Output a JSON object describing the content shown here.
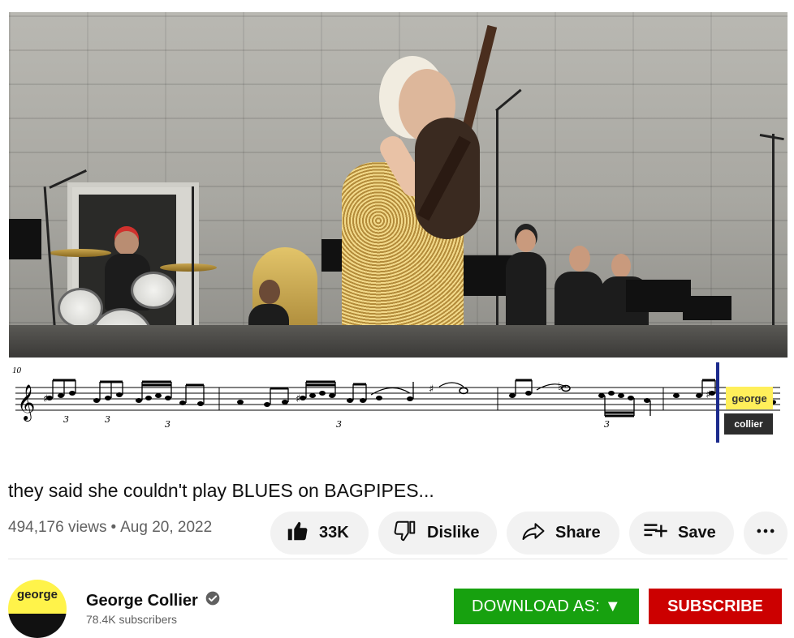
{
  "video": {
    "score": {
      "measure_number": "10",
      "watermark_top": "george",
      "watermark_bottom": "collier"
    }
  },
  "title": "they said she couldn't play BLUES on BAGPIPES...",
  "meta": {
    "views": "494,176 views",
    "separator": "•",
    "date": "Aug 20, 2022"
  },
  "actions": {
    "like_count": "33K",
    "dislike_label": "Dislike",
    "share_label": "Share",
    "save_label": "Save"
  },
  "channel": {
    "avatar_text": "george",
    "name": "George Collier",
    "subscribers": "78.4K subscribers",
    "verified": true
  },
  "buttons": {
    "download_label": "DOWNLOAD AS: ▼",
    "subscribe_label": "SUBSCRIBE"
  },
  "colors": {
    "download_green": "#17a10f",
    "subscribe_red": "#cc0000",
    "pill_gray": "#f2f2f2",
    "watermark_yellow": "#ffef5a",
    "playhead_blue": "#1b2a8c"
  },
  "icons": {
    "like": "thumbs-up-icon",
    "dislike": "thumbs-down-icon",
    "share": "share-arrow-icon",
    "save": "playlist-add-icon",
    "more": "more-horizontal-icon",
    "verified": "verified-check-icon"
  }
}
